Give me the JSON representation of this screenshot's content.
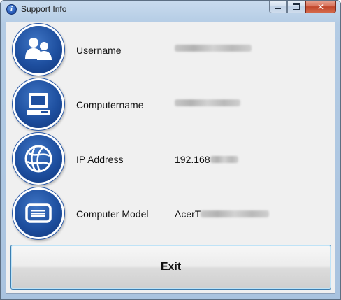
{
  "window": {
    "title": "Support Info",
    "app_icon_glyph": "i"
  },
  "caption": {
    "minimize_icon": "minimize-icon",
    "maximize_icon": "maximize-icon",
    "close_glyph": "✕"
  },
  "rows": [
    {
      "label": "Username",
      "value": "",
      "icon": "users-icon"
    },
    {
      "label": "Computername",
      "value": "",
      "icon": "computer-icon"
    },
    {
      "label": "IP Address",
      "value": "192.168",
      "icon": "globe-icon"
    },
    {
      "label": "Computer Model",
      "value": "AcerT",
      "icon": "keyboard-icon"
    }
  ],
  "exit_button": {
    "label": "Exit"
  },
  "colors": {
    "icon_blue": "#1e4f9f",
    "button_border": "#3c7fb1"
  }
}
